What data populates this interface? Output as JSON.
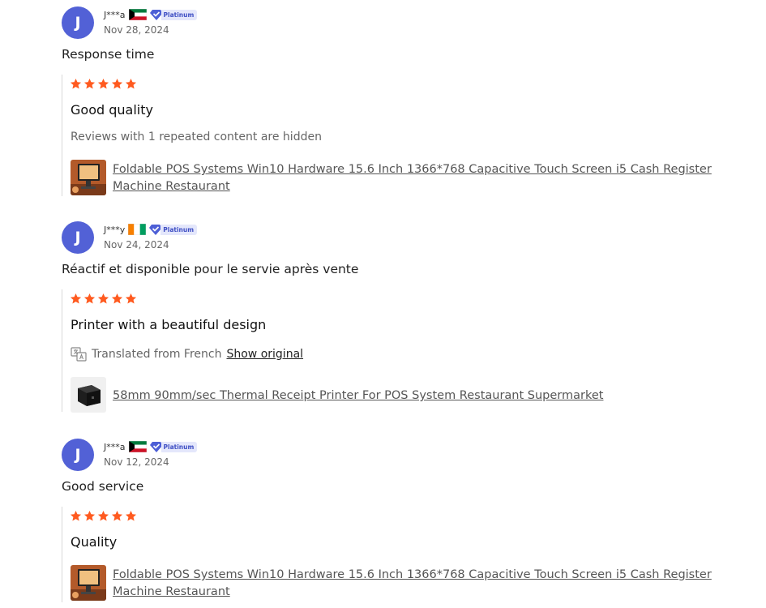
{
  "reviews": [
    {
      "avatar_letter": "J",
      "user": "J***a",
      "flag": "Kuwait",
      "badge": "Platinum",
      "date": "Nov 28, 2024",
      "comment": "Response time",
      "rating": 5,
      "headline": "Good quality",
      "hidden_note": "Reviews with 1 repeated content are hidden",
      "product_title": "Foldable POS Systems Win10 Hardware 15.6 Inch 1366*768 Capacitive Touch Screen i5 Cash Register Machine Restaurant"
    },
    {
      "avatar_letter": "J",
      "user": "J***y",
      "flag": "Ivory Coast",
      "badge": "Platinum",
      "date": "Nov 24, 2024",
      "comment": "Réactif et disponible pour le servie après vente",
      "rating": 5,
      "headline": "Printer with a beautiful design",
      "translated_label": "Translated from French",
      "show_original_label": "Show original",
      "product_title": "58mm 90mm/sec Thermal Receipt Printer For POS System Restaurant Supermarket"
    },
    {
      "avatar_letter": "J",
      "user": "J***a",
      "flag": "Kuwait",
      "badge": "Platinum",
      "date": "Nov 12, 2024",
      "comment": "Good service",
      "rating": 5,
      "headline": "Quality",
      "product_title": "Foldable POS Systems Win10 Hardware 15.6 Inch 1366*768 Capacitive Touch Screen i5 Cash Register Machine Restaurant"
    }
  ],
  "colors": {
    "avatar": "#5261d6",
    "star": "#ff5a1f",
    "badge_bg": "#e4e7fb",
    "badge_text": "#3f4fc4"
  }
}
